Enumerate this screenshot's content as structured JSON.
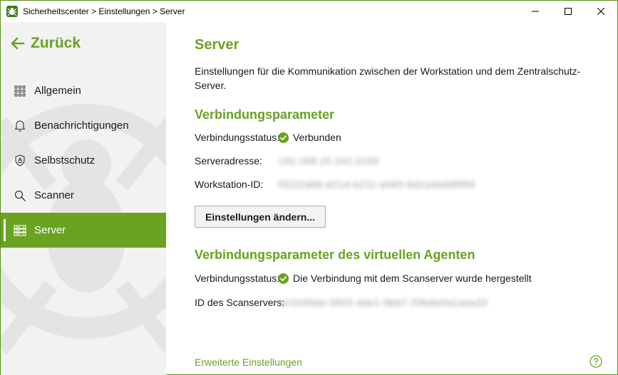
{
  "window": {
    "title": "Sicherheitscenter > Einstellungen > Server"
  },
  "sidebar": {
    "back_label": "Zurück",
    "items": [
      {
        "label": "Allgemein",
        "icon": "grid-icon",
        "active": false
      },
      {
        "label": "Benachrichtigungen",
        "icon": "bell-icon",
        "active": false
      },
      {
        "label": "Selbstschutz",
        "icon": "shield-icon",
        "active": false
      },
      {
        "label": "Scanner",
        "icon": "search-icon",
        "active": false
      },
      {
        "label": "Server",
        "icon": "server-icon",
        "active": true
      }
    ]
  },
  "main": {
    "title": "Server",
    "description": "Einstellungen für die Kommunikation zwischen der Workstation und dem Zentralschutz-Server.",
    "connection": {
      "section_title": "Verbindungsparameter",
      "status_label": "Verbindungsstatus:",
      "status_value": "Verbunden",
      "address_label": "Serveradresse:",
      "address_value": "192.168.20.242:2193",
      "workstation_label": "Workstation-ID:",
      "workstation_value": "f3222a89-d21d-b211-a583-8d1a4a9d9f69",
      "change_button": "Einstellungen ändern..."
    },
    "virtual_agent": {
      "section_title": "Verbindungsparameter des virtuellen Agenten",
      "status_label": "Verbindungsstatus:",
      "status_value": "Die Verbindung mit dem Scanserver wurde hergestellt",
      "scanserver_label": "ID des Scanservers:",
      "scanserver_value": "4e1b39da-3903-4de1-9b67-29bde0a1aea33"
    },
    "advanced_link": "Erweiterte Einstellungen"
  },
  "colors": {
    "accent": "#6aa221",
    "sidebar_bg": "#f2f2f2",
    "status_ok": "#6aa221"
  }
}
